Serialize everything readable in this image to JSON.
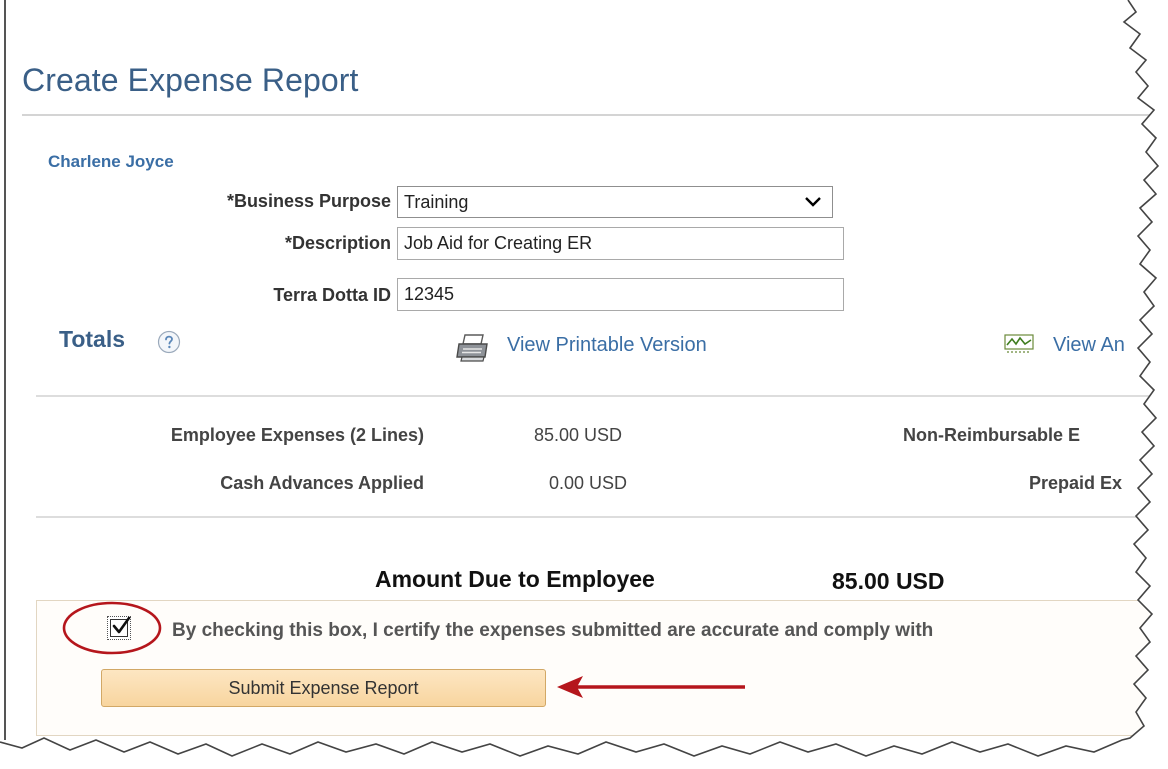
{
  "page": {
    "title": "Create Expense Report"
  },
  "employee": {
    "name": "Charlene Joyce"
  },
  "form": {
    "business_purpose": {
      "label": "*Business Purpose",
      "value": "Training"
    },
    "description": {
      "label": "*Description",
      "value": "Job Aid for Creating ER"
    },
    "terra_dotta_id": {
      "label": "Terra Dotta ID",
      "value": "12345"
    }
  },
  "totals": {
    "heading": "Totals",
    "help_icon": "question-circle-icon",
    "links": {
      "printable": "View Printable Version",
      "analytics_partial": "View An"
    },
    "rows": [
      {
        "label": "Employee Expenses (2 Lines)",
        "value": "85.00  USD"
      },
      {
        "label": "Cash Advances Applied",
        "value": "0.00  USD"
      }
    ],
    "right_labels": [
      "Non-Reimbursable E",
      "Prepaid Ex"
    ]
  },
  "amount_due": {
    "label": "Amount Due to Employee",
    "value": "85.00  USD"
  },
  "certification": {
    "checked": true,
    "text": "By checking this box, I certify the expenses submitted are accurate and comply with"
  },
  "actions": {
    "submit_label": "Submit Expense Report"
  },
  "colors": {
    "title": "#3a5f87",
    "link": "#3a6ea5",
    "annotation": "#b5161c",
    "button_fill": "#fde6c2"
  }
}
